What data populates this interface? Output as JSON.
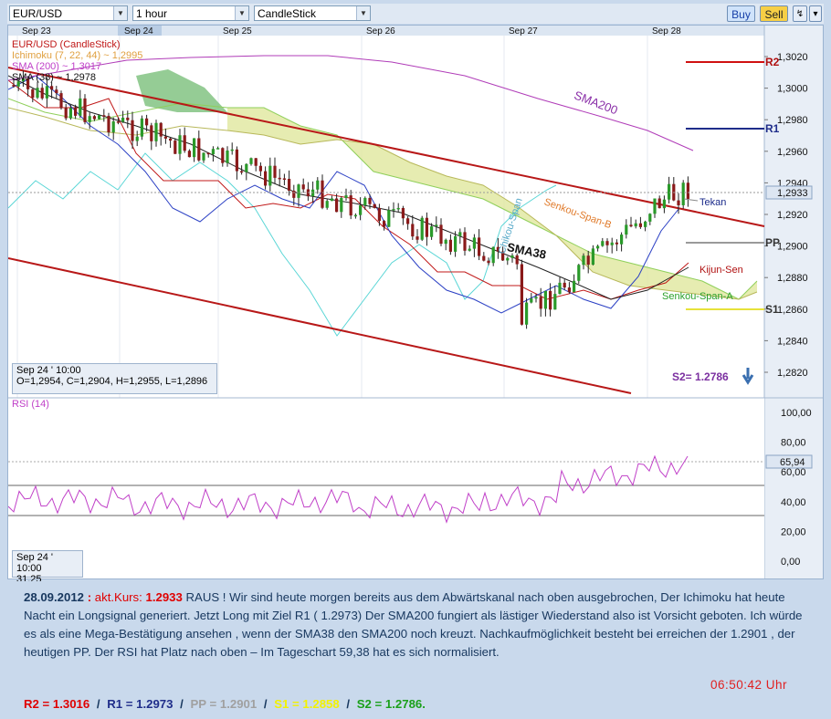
{
  "toolbar": {
    "symbol": "EUR/USD",
    "interval": "1 hour",
    "chart_type": "CandleStick",
    "buy_label": "Buy",
    "sell_label": "Sell"
  },
  "dates": [
    "Sep 23",
    "Sep 24",
    "Sep 25",
    "Sep 26",
    "Sep 27",
    "Sep 28"
  ],
  "legend": {
    "main": "EUR/USD (CandleStick)",
    "ichimoku": "Ichimoku (7, 22, 44) ~ 1,2995",
    "sma200": "SMA (200) ~ 1,3017",
    "sma38": "SMA (38) ~ 1,2978"
  },
  "price_axis": [
    "1,3020",
    "1,3000",
    "1,2980",
    "1,2960",
    "1,2940",
    "1,2920",
    "1,2900",
    "1,2880",
    "1,2860",
    "1,2840",
    "1,2820"
  ],
  "current_price": "1,2933",
  "annotations": {
    "r2": "R2",
    "r1": "R1",
    "pp": "PP",
    "s1": "S1",
    "s2": "S2= 1.2786",
    "sma200": "SMA200",
    "sma38": "SMA38",
    "tekan": "Tekan",
    "kijun": "Kijun-Sen",
    "span_a": "Senkou-Span-A",
    "span_b": "Senkou-Span-B",
    "chikou": "Chikou-Span"
  },
  "info_main": {
    "date": "Sep 24 ' 10:00",
    "ohlc": "O=1,2954, C=1,2904, H=1,2955, L=1,2896"
  },
  "rsi": {
    "label": "RSI (14)",
    "axis": [
      "100,00",
      "80,00",
      "60,00",
      "40,00",
      "20,00",
      "0,00"
    ],
    "current": "65,94",
    "info_date": "Sep 24 ' 10:00",
    "info_value": "31,25"
  },
  "comment": {
    "date": "28.09.2012",
    "colon": ":",
    "kurs_label": "akt.Kurs:",
    "kurs_value": "1.2933",
    "body": "RAUS ! Wir sind heute morgen bereits aus dem Abwärtskanal nach oben ausgebrochen, Der Ichimoku hat heute Nacht ein Longsignal generiert.  Jetzt Long mit Ziel R1 ( 1.2973) Der SMA200 fungiert als lästiger Wiederstand also ist Vorsicht geboten.  Ich würde es als eine Mega-Bestätigung ansehen , wenn der SMA38 den SMA200 noch kreuzt. Nachkaufmöglichkeit besteht bei erreichen der 1.2901 , der heutigen PP. Der RSI hat Platz nach oben – Im Tageschart 59,38 hat es sich normalisiert.",
    "clock": "06:50:42 Uhr",
    "r2": "R2 = 1.3016",
    "r1": "R1 = 1.2973",
    "pp": "PP = 1.2901",
    "s1": "S1 = 1.2858",
    "s2": "S2 =  1.2786.",
    "sep": "/",
    "colors": {
      "r2": "#e00000",
      "r1": "#1f2d8a",
      "pp": "#a0a0a0",
      "s1": "#f2f200",
      "s2": "#1aa01a"
    }
  }
}
